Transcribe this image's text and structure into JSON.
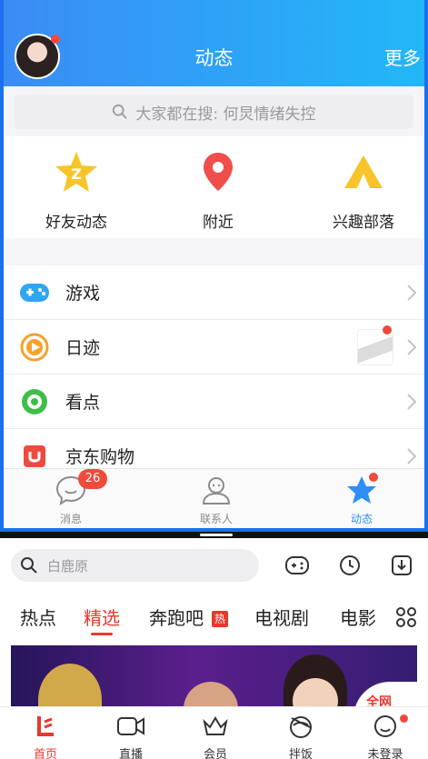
{
  "qq": {
    "header": {
      "title": "动态",
      "more": "更多"
    },
    "search": {
      "placeholder": "大家都在搜: 何炅情绪失控"
    },
    "quick": [
      {
        "label": "好友动态",
        "icon": "star-z-icon"
      },
      {
        "label": "附近",
        "icon": "location-pin-icon"
      },
      {
        "label": "兴趣部落",
        "icon": "tent-icon"
      }
    ],
    "list": [
      {
        "label": "游戏",
        "icon": "gamepad-icon"
      },
      {
        "label": "日迹",
        "icon": "play-circle-icon"
      },
      {
        "label": "看点",
        "icon": "eye-icon"
      },
      {
        "label": "京东购物",
        "icon": "jd-bag-icon"
      }
    ],
    "tabs": [
      {
        "label": "消息",
        "badge": "26"
      },
      {
        "label": "联系人"
      },
      {
        "label": "动态"
      }
    ],
    "colors": {
      "accent": "#2e8ff5",
      "badge": "#f04a3a"
    }
  },
  "video": {
    "search": {
      "placeholder": "白鹿原"
    },
    "categories": [
      "热点",
      "精选",
      "奔跑吧",
      "电视剧",
      "电影"
    ],
    "hot_tag": "热",
    "banner": {
      "badge": "全网"
    },
    "tabs": [
      {
        "label": "首页"
      },
      {
        "label": "直播"
      },
      {
        "label": "会员"
      },
      {
        "label": "拌饭"
      },
      {
        "label": "未登录"
      }
    ],
    "colors": {
      "accent": "#e8382d"
    }
  }
}
